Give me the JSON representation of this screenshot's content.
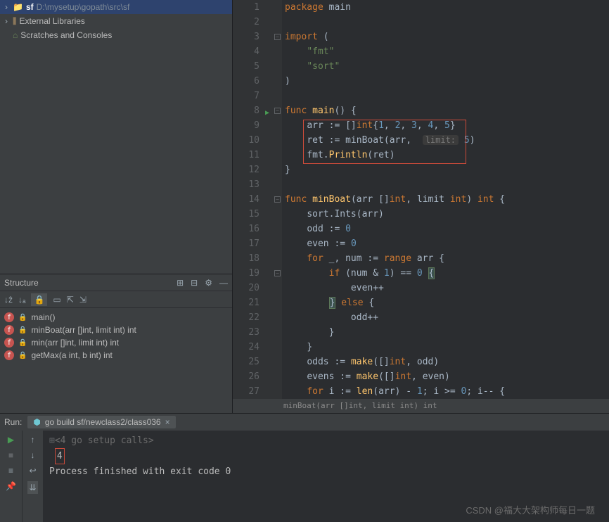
{
  "project": {
    "root": {
      "name": "sf",
      "path": "D:\\mysetup\\gopath\\src\\sf"
    },
    "items": [
      {
        "name": "External Libraries"
      },
      {
        "name": "Scratches and Consoles"
      }
    ]
  },
  "structure": {
    "title": "Structure",
    "items": [
      {
        "label": "main()"
      },
      {
        "label": "minBoat(arr []int, limit int) int"
      },
      {
        "label": "min(arr []int, limit int) int"
      },
      {
        "label": "getMax(a int, b int) int"
      }
    ]
  },
  "code": {
    "package": "package",
    "main_name": "main",
    "import": "import",
    "imp_fmt": "\"fmt\"",
    "imp_sort": "\"sort\"",
    "func": "func",
    "main_sig": "main() {",
    "l9_a": "arr := []",
    "l9_b": "int",
    "l9_n1": "1",
    "l9_n2": "2",
    "l9_n3": "3",
    "l9_n4": "4",
    "l9_n5": "5",
    "l10_a": "ret := minBoat(arr, ",
    "l10_hint": "limit:",
    "l10_n": "5",
    "l11": "fmt.",
    "l11_fn": "Println",
    "l11_b": "(ret)",
    "minBoat_sig": "minBoat(arr []",
    "int_kw": "int",
    "limit_param": ", limit ",
    "ret_int": ") ",
    "l15": "sort.Ints(arr)",
    "l16_a": "odd := ",
    "l16_n": "0",
    "l17_a": "even := ",
    "l17_n": "0",
    "l18_a": "for",
    "l18_b": " _, num := ",
    "l18_c": "range",
    "l18_d": " arr {",
    "l19_a": "if",
    "l19_b": " (num & ",
    "l19_c": "1",
    "l19_d": ") == ",
    "l19_e": "0",
    "l19_f": " ",
    "l20": "even++",
    "l21_a": "}",
    "l21_b": " else ",
    "l21_c": "{",
    "l22": "odd++",
    "l25_a": "odds := ",
    "l25_b": "make",
    "l25_c": "([]",
    "l25_d": ", odd)",
    "l26_a": "evens := ",
    "l26_d": ", even)",
    "l27_a": "for",
    "l27_b": " i := ",
    "l27_c": "len",
    "l27_d": "(arr) - ",
    "l27_e": "1",
    "l27_f": "; i >= ",
    "l27_g": "0",
    "l27_h": "; i-- {",
    "close_brace": "}"
  },
  "crumb": "minBoat(arr []int, limit int) int",
  "run": {
    "label": "Run:",
    "tab": "go build sf/newclass2/class036",
    "setup": "<4 go setup calls>",
    "output": "4",
    "exit": "Process finished with exit code 0"
  },
  "gutter": [
    "1",
    "2",
    "3",
    "4",
    "5",
    "6",
    "7",
    "8",
    "9",
    "10",
    "11",
    "12",
    "13",
    "14",
    "15",
    "16",
    "17",
    "18",
    "19",
    "20",
    "21",
    "22",
    "23",
    "24",
    "25",
    "26",
    "27"
  ],
  "watermark": "CSDN @福大大架构师每日一题"
}
